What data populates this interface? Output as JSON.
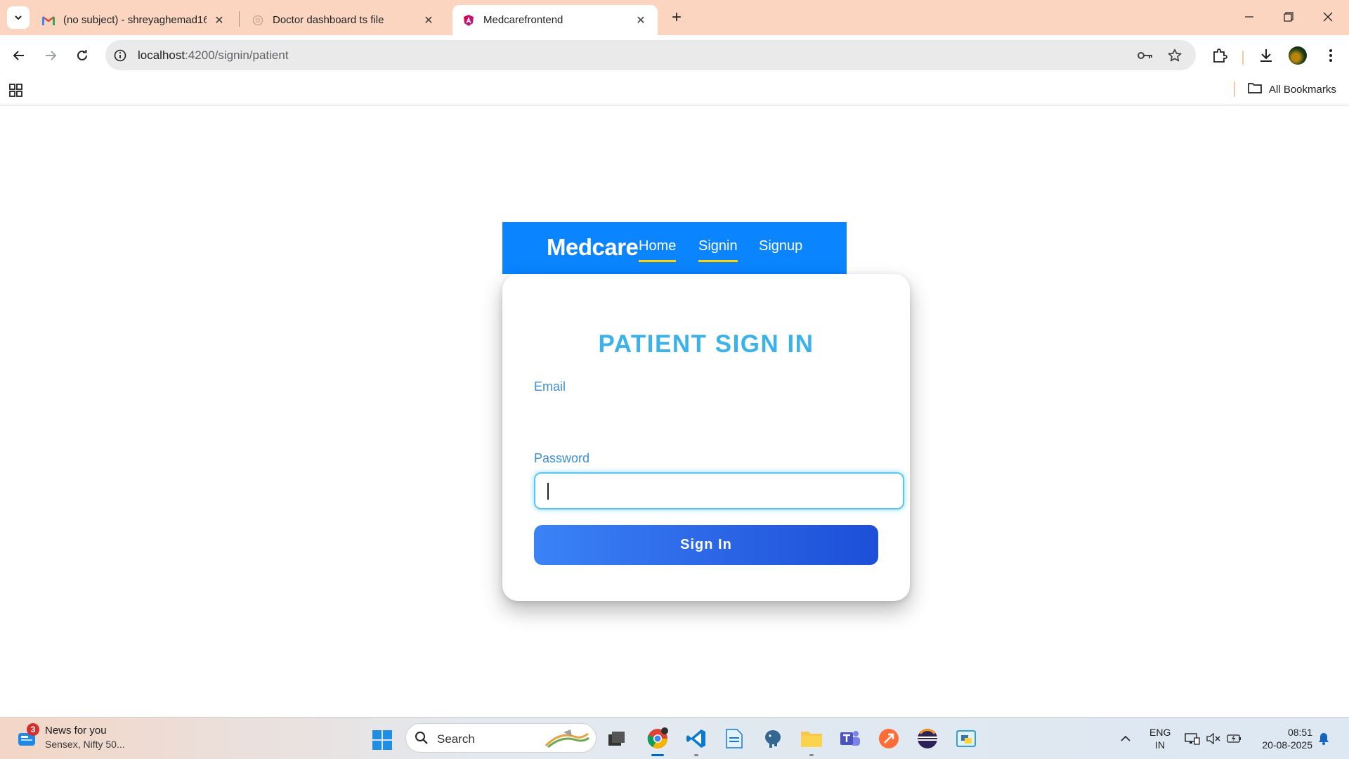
{
  "browser": {
    "tabs": [
      {
        "title": "(no subject) - shreyaghemad16",
        "favicon": "gmail-icon"
      },
      {
        "title": "Doctor dashboard ts file",
        "favicon": "chatgpt-icon"
      },
      {
        "title": "Medcarefrontend",
        "favicon": "angular-icon",
        "active": true
      }
    ],
    "url_host": "localhost",
    "url_rest": ":4200/signin/patient",
    "bookmarks_label": "All Bookmarks"
  },
  "app": {
    "brand": "Medcare",
    "nav": [
      {
        "label": "Home"
      },
      {
        "label": "Signin"
      },
      {
        "label": "Signup"
      }
    ],
    "title": "PATIENT SIGN IN",
    "email_label": "Email",
    "password_label": "Password",
    "email_value": "",
    "password_value": "",
    "button_label": "Sign In",
    "colors": {
      "nav_bg": "#0a84ff",
      "title": "#3bb2ea",
      "label": "#3c8fd6",
      "button_from": "#3b82f6",
      "button_to": "#1d4ed8",
      "underline": "#ffd400"
    }
  },
  "taskbar": {
    "news_badge": "3",
    "news_title": "News for you",
    "news_subtitle": "Sensex, Nifty 50...",
    "search_label": "Search",
    "lang_line1": "ENG",
    "lang_line2": "IN",
    "time": "08:51",
    "date": "20-08-2025"
  }
}
